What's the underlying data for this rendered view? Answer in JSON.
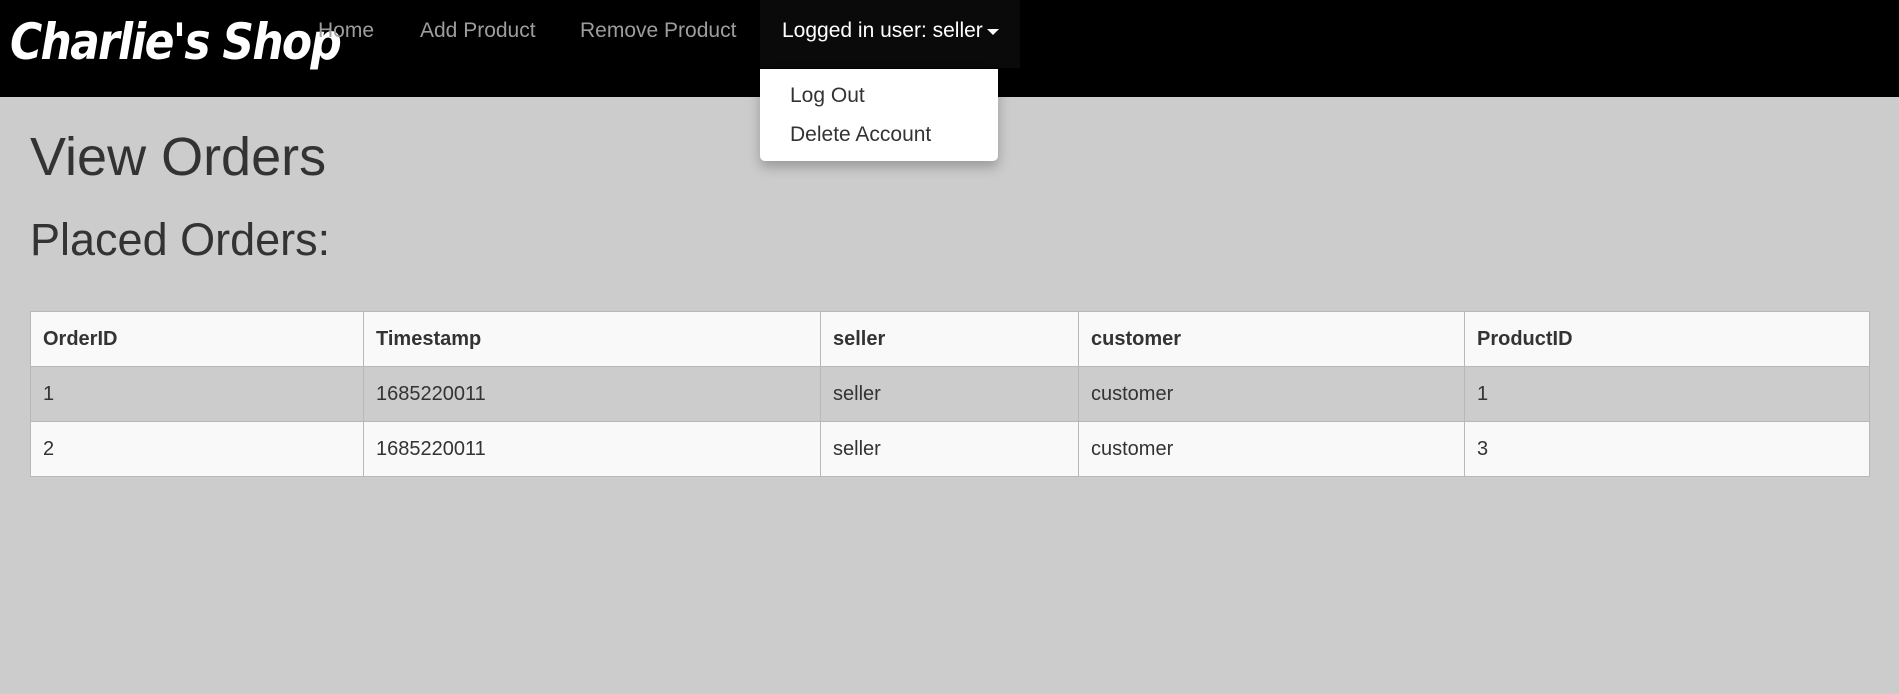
{
  "navbar": {
    "brand": "Charlie's Shop",
    "links": [
      "Home",
      "Add Product",
      "Remove Product"
    ],
    "user_menu_label": "Logged in user: seller"
  },
  "dropdown": {
    "items": [
      "Log Out",
      "Delete Account"
    ]
  },
  "page": {
    "title": "View Orders",
    "section_title": "Placed Orders:"
  },
  "table": {
    "headers": [
      "OrderID",
      "Timestamp",
      "seller",
      "customer",
      "ProductID"
    ],
    "rows": [
      [
        "1",
        "1685220011",
        "seller",
        "customer",
        "1"
      ],
      [
        "2",
        "1685220011",
        "seller",
        "customer",
        "3"
      ]
    ]
  },
  "colors": {
    "navbar_bg": "#000000",
    "page_bg": "#cccccc",
    "nav_link": "#9d9d9d"
  }
}
